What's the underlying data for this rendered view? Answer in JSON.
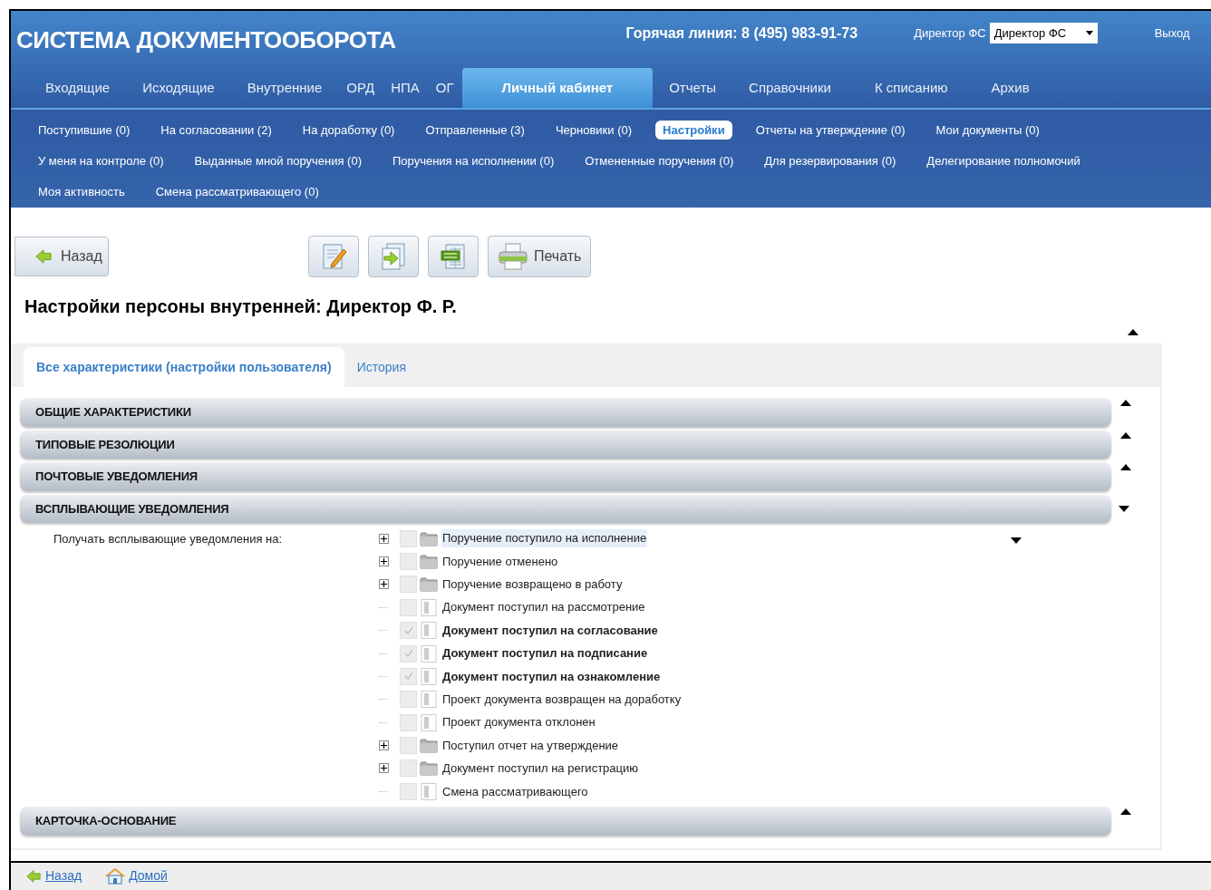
{
  "header": {
    "title": "СИСТЕМА ДОКУМЕНТООБОРОТА",
    "hotline": "Горячая линия: 8 (495) 983-91-73",
    "user_label": "Директор ФС",
    "user_select": "Директор ФС",
    "logout": "Выход"
  },
  "main_tabs": [
    {
      "label": "Входящие",
      "selected": false
    },
    {
      "label": "Исходящие",
      "selected": false
    },
    {
      "label": "Внутренние",
      "selected": false
    },
    {
      "label": "ОРД",
      "selected": false
    },
    {
      "label": "НПА",
      "selected": false
    },
    {
      "label": "ОГ",
      "selected": false
    },
    {
      "label": "Личный кабинет",
      "selected": true
    },
    {
      "label": "Отчеты",
      "selected": false
    },
    {
      "label": "Справочники",
      "selected": false
    },
    {
      "label": "К списанию",
      "selected": false
    },
    {
      "label": "Архив",
      "selected": false
    }
  ],
  "sub_nav": [
    [
      {
        "label": "Поступившие (0)",
        "selected": false
      },
      {
        "label": "На согласовании (2)",
        "selected": false
      },
      {
        "label": "На доработку (0)",
        "selected": false
      },
      {
        "label": "Отправленные (3)",
        "selected": false
      },
      {
        "label": "Черновики (0)",
        "selected": false
      },
      {
        "label": "Настройки",
        "selected": true
      },
      {
        "label": "Отчеты на утверждение (0)",
        "selected": false
      },
      {
        "label": "Мои документы (0)",
        "selected": false
      }
    ],
    [
      {
        "label": "У меня на контроле (0)",
        "selected": false
      },
      {
        "label": "Выданные мной поручения (0)",
        "selected": false
      },
      {
        "label": "Поручения на исполнении (0)",
        "selected": false
      },
      {
        "label": "Отмененные поручения (0)",
        "selected": false
      },
      {
        "label": "Для резервирования (0)",
        "selected": false
      },
      {
        "label": "Делегирование полномочий",
        "selected": false
      }
    ],
    [
      {
        "label": "Моя активность",
        "selected": false
      },
      {
        "label": "Смена рассматривающего (0)",
        "selected": false
      }
    ]
  ],
  "toolbar": {
    "back": "Назад",
    "print": "Печать"
  },
  "page_title": "Настройки персоны внутренней: Директор Ф. Р.",
  "content_tabs": [
    {
      "label": "Все характеристики (настройки пользователя)",
      "selected": true
    },
    {
      "label": "История",
      "selected": false
    }
  ],
  "sections": [
    {
      "title": "ОБЩИЕ ХАРАКТЕРИСТИКИ",
      "expanded": false
    },
    {
      "title": "ТИПОВЫЕ РЕЗОЛЮЦИИ",
      "expanded": false
    },
    {
      "title": "ПОЧТОВЫЕ УВЕДОМЛЕНИЯ",
      "expanded": false
    },
    {
      "title": "ВСПЛЫВАЮЩИЕ УВЕДОМЛЕНИЯ",
      "expanded": true,
      "field_label": "Получать всплывающие уведомления на:",
      "items": [
        {
          "label": "Поручение поступило на исполнение",
          "kind": "folder",
          "checked": false,
          "selected": true
        },
        {
          "label": "Поручение отменено",
          "kind": "folder",
          "checked": false,
          "selected": false
        },
        {
          "label": "Поручение возвращено в работу",
          "kind": "folder",
          "checked": false,
          "selected": false
        },
        {
          "label": "Документ поступил на рассмотрение",
          "kind": "document",
          "checked": false,
          "selected": false
        },
        {
          "label": "Документ поступил на согласование",
          "kind": "document",
          "checked": true,
          "selected": false
        },
        {
          "label": "Документ поступил на подписание",
          "kind": "document",
          "checked": true,
          "selected": false
        },
        {
          "label": "Документ поступил на ознакомление",
          "kind": "document",
          "checked": true,
          "selected": false
        },
        {
          "label": "Проект документа возвращен на доработку",
          "kind": "document",
          "checked": false,
          "selected": false
        },
        {
          "label": "Проект документа отклонен",
          "kind": "document",
          "checked": false,
          "selected": false
        },
        {
          "label": "Поступил отчет на утверждение",
          "kind": "folder",
          "checked": false,
          "selected": false
        },
        {
          "label": "Документ поступил на регистрацию",
          "kind": "folder",
          "checked": false,
          "selected": false
        },
        {
          "label": "Смена рассматривающего",
          "kind": "document",
          "checked": false,
          "selected": false
        }
      ]
    },
    {
      "title": "КАРТОЧКА-ОСНОВАНИЕ",
      "expanded": false
    }
  ],
  "footer_links": [
    {
      "label": "Назад",
      "kind": "back"
    },
    {
      "label": "Домой",
      "kind": "home"
    }
  ]
}
